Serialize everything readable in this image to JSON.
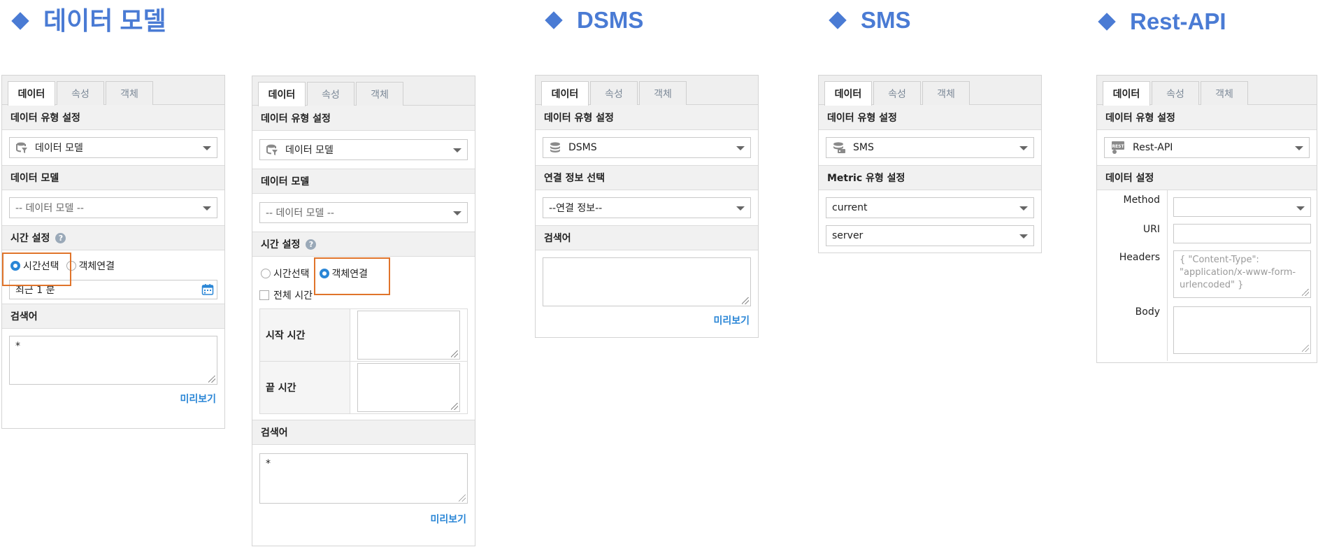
{
  "headings": {
    "data_model": "데이터 모델",
    "dsms": "DSMS",
    "sms": "SMS",
    "rest_api": "Rest-API"
  },
  "tabs": {
    "data": "데이터",
    "property": "속성",
    "object": "객체"
  },
  "labels": {
    "data_type_setting": "데이터 유형 설정",
    "data_model": "데이터 모델",
    "time_setting": "시간 설정",
    "search_term": "검색어",
    "preview": "미리보기",
    "connection_info_select": "연결 정보 선택",
    "metric_type_setting": "Metric 유형 설정",
    "data_setting": "데이터 설정"
  },
  "panel1": {
    "data_type_value": "데이터 모델",
    "data_model_value": "-- 데이터 모델 --",
    "radio_time": "시간선택",
    "radio_object": "객체연결",
    "time_value": "최근 1 분",
    "search_value": "*"
  },
  "panel2": {
    "data_type_value": "데이터 모델",
    "data_model_value": "-- 데이터 모델 --",
    "radio_time": "시간선택",
    "radio_object": "객체연결",
    "all_time": "전체 시간",
    "start_time": "시작 시간",
    "end_time": "끝 시간",
    "search_value": "*"
  },
  "panel3": {
    "data_type_value": "DSMS",
    "connection_value": "--연결 정보--"
  },
  "panel4": {
    "data_type_value": "SMS",
    "metric_1": "current",
    "metric_2": "server"
  },
  "panel5": {
    "data_type_value": "Rest-API",
    "method_label": "Method",
    "uri_label": "URI",
    "headers_label": "Headers",
    "headers_placeholder": "{ \"Content-Type\": \"application/x-www-form-urlencoded\" }",
    "body_label": "Body"
  },
  "colors": {
    "heading": "#4a7bd4",
    "accent": "#2a86d6",
    "highlight": "#e0742b"
  },
  "icons": [
    "diamond-icon",
    "database-filter-icon",
    "database-icon",
    "server-icon",
    "rest-icon",
    "calendar-icon",
    "help-icon"
  ]
}
